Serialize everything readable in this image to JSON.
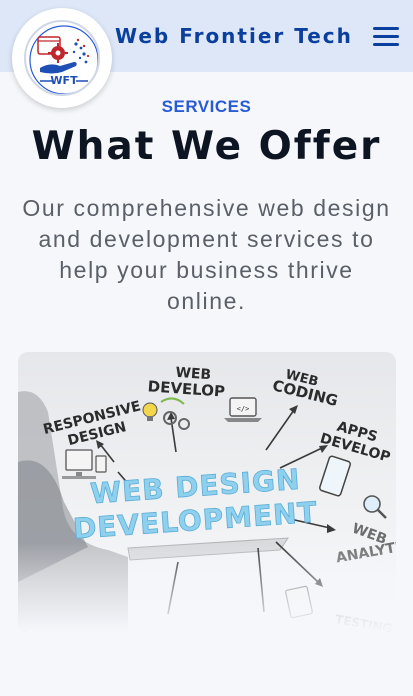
{
  "header": {
    "brand": "Web Frontier Tech",
    "logo_text": "WFT",
    "menu_icon": "hamburger-icon"
  },
  "services": {
    "eyebrow": "SERVICES",
    "heading": "What We Offer",
    "description": "Our comprehensive web design and development services to help your business thrive online."
  },
  "hero": {
    "main_line1": "WEB DESIGN",
    "main_line2": "DEVELOPMENT",
    "labels": {
      "web_develop_1": "WEB",
      "web_develop_2": "DEVELOP",
      "web_coding_1": "WEB",
      "web_coding_2": "CODING",
      "responsive_1": "RESPONSIVE",
      "responsive_2": "DESIGN",
      "apps_1": "APPS",
      "apps_2": "DEVELOP",
      "analytics_1": "WEB",
      "analytics_2": "ANALYTIC",
      "testing": "TESTING"
    },
    "colors": {
      "main_text": "#8fd0ee",
      "label_text": "#2b2b2b"
    }
  },
  "colors": {
    "brand": "#0b3f9e",
    "accent": "#2a5bd7",
    "heading": "#0d1522",
    "header_bg": "#dde7f7",
    "page_bg": "#f5f7fb"
  }
}
